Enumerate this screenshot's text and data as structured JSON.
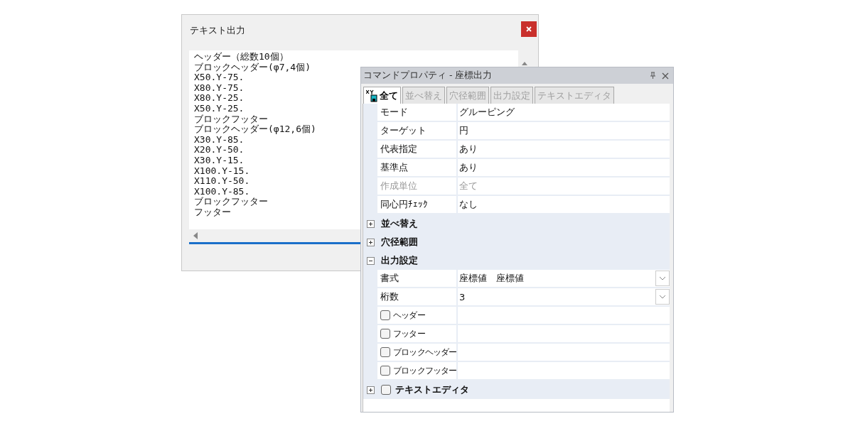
{
  "text_window": {
    "title": "テキスト出力",
    "lines": [
      "ヘッダー（総数10個）",
      "ブロックヘッダー(φ7,4個)",
      "X50.Y-75.",
      "X80.Y-75.",
      "X80.Y-25.",
      "X50.Y-25.",
      "ブロックフッター",
      "ブロックヘッダー(φ12,6個)",
      "X30.Y-85.",
      "X20.Y-50.",
      "X30.Y-15.",
      "X100.Y-15.",
      "X110.Y-50.",
      "X100.Y-85.",
      "ブロックフッター",
      "フッター"
    ]
  },
  "property_panel": {
    "title": "コマンドプロパティ - 座標出力",
    "tabs": [
      {
        "label": "全て",
        "selected": true
      },
      {
        "label": "並べ替え",
        "selected": false
      },
      {
        "label": "穴径範囲",
        "selected": false
      },
      {
        "label": "出力設定",
        "selected": false
      },
      {
        "label": "テキストエディタ",
        "selected": false
      }
    ],
    "rows": [
      {
        "kind": "property",
        "name": "モード",
        "value": "グルーピング",
        "disabled": false
      },
      {
        "kind": "property",
        "name": "ターゲット",
        "value": "円",
        "disabled": false
      },
      {
        "kind": "property",
        "name": "代表指定",
        "value": "あり",
        "disabled": false
      },
      {
        "kind": "property",
        "name": "基準点",
        "value": "あり",
        "disabled": false
      },
      {
        "kind": "property",
        "name": "作成単位",
        "value": "全て",
        "disabled": true
      },
      {
        "kind": "property",
        "name": "同心円ﾁｪｯｸ",
        "value": "なし",
        "disabled": false
      },
      {
        "kind": "category",
        "name": "並べ替え",
        "expanded": false
      },
      {
        "kind": "category",
        "name": "穴径範囲",
        "expanded": false
      },
      {
        "kind": "category",
        "name": "出力設定",
        "expanded": true
      },
      {
        "kind": "dropdown",
        "name": "書式",
        "value": "座標値　座標値"
      },
      {
        "kind": "dropdown",
        "name": "桁数",
        "value": "3"
      },
      {
        "kind": "checkbox",
        "name": "ヘッダー",
        "checked": false
      },
      {
        "kind": "checkbox",
        "name": "フッター",
        "checked": false
      },
      {
        "kind": "checkbox",
        "name": "ブロックヘッダー",
        "checked": false
      },
      {
        "kind": "checkbox",
        "name": "ブロックフッター",
        "checked": false
      },
      {
        "kind": "category_check",
        "name": "テキストエディタ",
        "expanded": false,
        "checked": false
      }
    ]
  }
}
